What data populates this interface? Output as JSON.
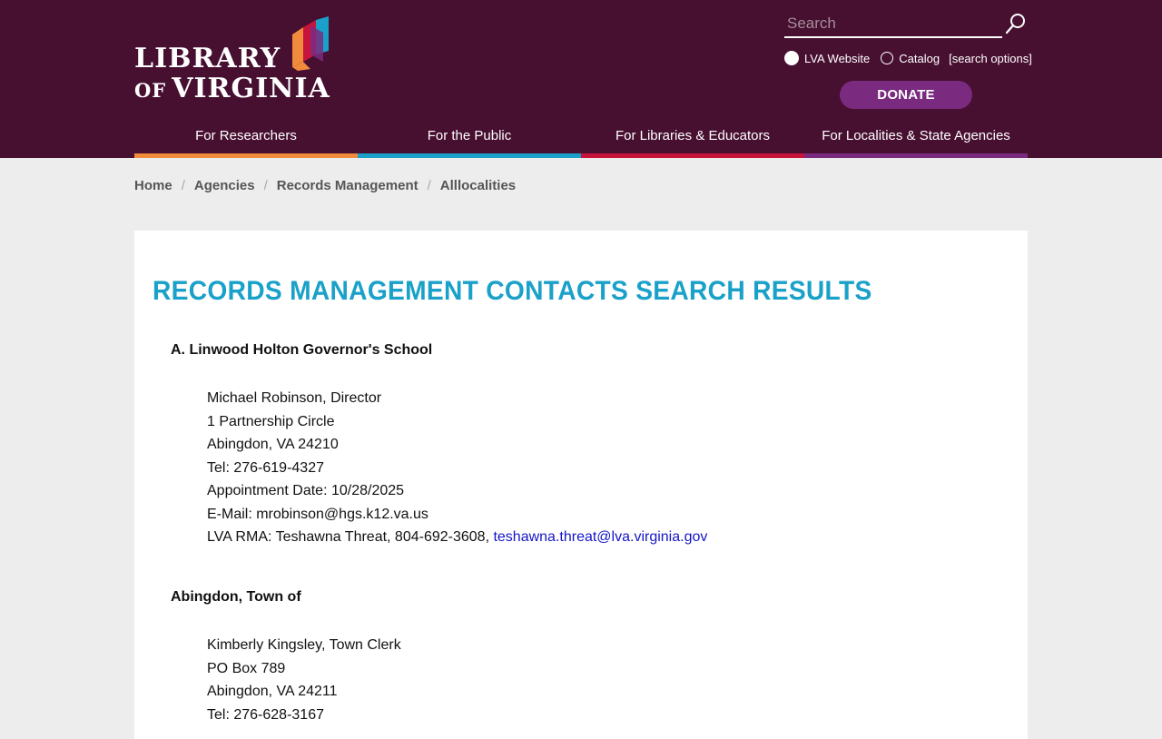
{
  "logo": {
    "line1": "LIBRARY",
    "line2_of": "OF",
    "line2_name": "VIRGINIA"
  },
  "search": {
    "placeholder": "Search",
    "icon": "magnifier-icon",
    "scopes": [
      {
        "label": "LVA Website",
        "selected": true
      },
      {
        "label": "Catalog",
        "selected": false
      }
    ],
    "options_link": "[search options]"
  },
  "donate_label": "DONATE",
  "nav": [
    {
      "label": "For Researchers",
      "color": "#f08a3c"
    },
    {
      "label": "For the Public",
      "color": "#1aa1c9"
    },
    {
      "label": "For Libraries & Educators",
      "color": "#c8143c"
    },
    {
      "label": "For Localities & State Agencies",
      "color": "#7a2b7f"
    }
  ],
  "breadcrumb": [
    "Home",
    "Agencies",
    "Records Management",
    "Alllocalities"
  ],
  "page_title": "RECORDS MANAGEMENT CONTACTS SEARCH RESULTS",
  "results": [
    {
      "entity": "A. Linwood Holton Governor's School",
      "name_title": "Michael Robinson, Director",
      "address1": "1 Partnership Circle",
      "city_state_zip": "Abingdon, VA 24210",
      "tel": "Tel: 276-619-4327",
      "appointment": "Appointment Date: 10/28/2025",
      "email": "E-Mail: mrobinson@hgs.k12.va.us",
      "rma_prefix": "LVA RMA: Teshawna Threat, 804-692-3608, ",
      "rma_email": "teshawna.threat@lva.virginia.gov"
    },
    {
      "entity": "Abingdon, Town of",
      "name_title": "Kimberly Kingsley, Town Clerk",
      "address1": "PO Box 789",
      "city_state_zip": "Abingdon, VA 24211",
      "tel": "Tel: 276-628-3167"
    }
  ],
  "colors": {
    "header_bg": "#470f30",
    "title": "#1aa1c9",
    "link": "#1515c8",
    "donate_bg": "#7a2b7f"
  }
}
